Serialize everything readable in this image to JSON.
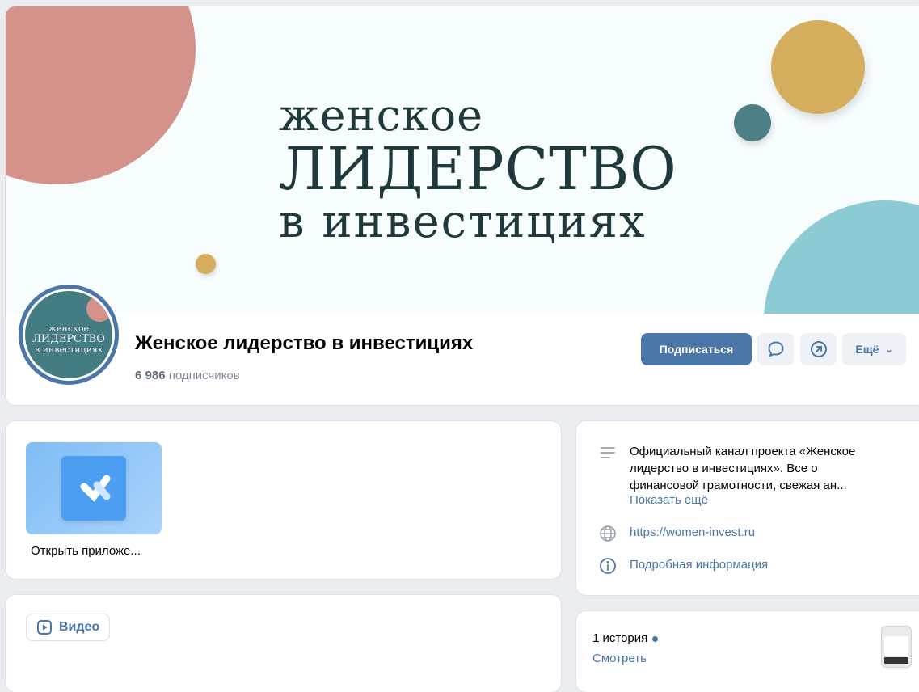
{
  "header": {
    "cover": {
      "line1": "женское",
      "line2": "ЛИДЕРСТВО",
      "line3": "в инвестициях"
    },
    "avatar": {
      "line1": "женское",
      "line2": "ЛИДЕРСТВО",
      "line3": "в инвестициях"
    },
    "group_name": "Женское лидерство в инвестициях",
    "subscribers_count": "6 986",
    "subscribers_label": "подписчиков",
    "buttons": {
      "subscribe": "Подписаться",
      "message_icon": "chat-bubble-icon",
      "share_icon": "share-arrow-icon",
      "more": "Ещё"
    }
  },
  "app": {
    "label": "Открыть приложе...",
    "icon": "vk-app-icon"
  },
  "video": {
    "label": "Видео",
    "icon": "play-icon"
  },
  "info": {
    "description": "Официальный канал проекта «Женское лидерство в инвестициях». Все о финансовой грамотности, свежая ан...",
    "show_more": "Показать ещё",
    "website": "https://women-invest.ru",
    "details": "Подробная информация"
  },
  "stories": {
    "count_label": "1 история",
    "watch": "Смотреть"
  },
  "colors": {
    "accent": "#4a76a8",
    "cover_pink": "#d4928a",
    "cover_gold": "#d4ae5c",
    "cover_teal": "#4d7f87",
    "cover_cyan": "#8ccbd4",
    "page_bg": "#ebedf0"
  }
}
